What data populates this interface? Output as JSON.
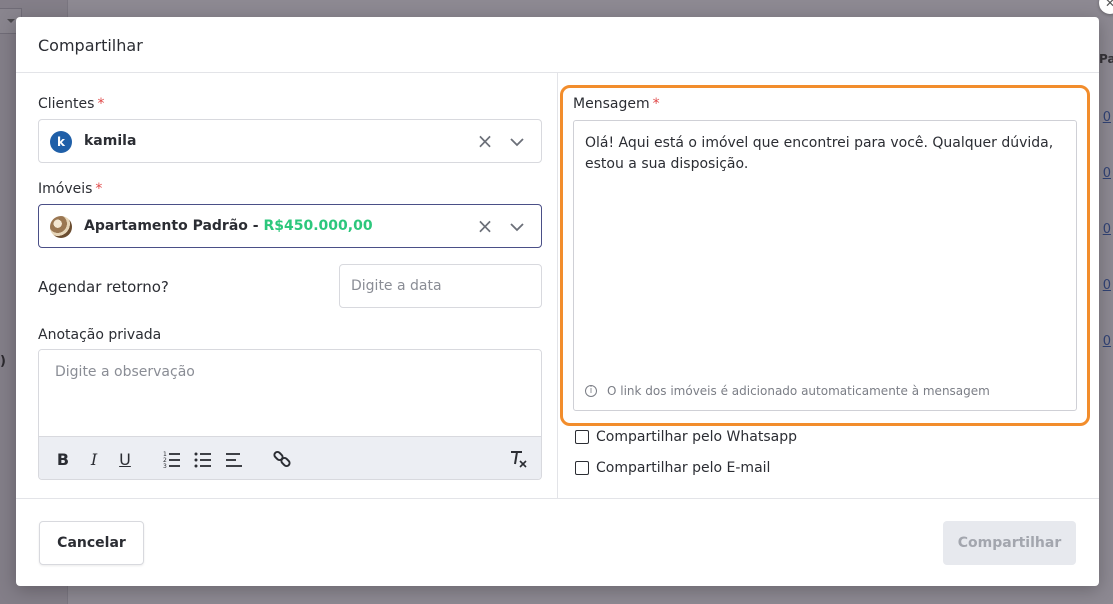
{
  "modal": {
    "title": "Compartilhar"
  },
  "form": {
    "clientes": {
      "label": "Clientes",
      "required_mark": "*",
      "avatar_letter": "k",
      "value": "kamila"
    },
    "imoveis": {
      "label": "Imóveis",
      "required_mark": "*",
      "value_name": "Apartamento Padrão - ",
      "value_price": "R$450.000,00"
    },
    "agendar": {
      "label": "Agendar retorno?",
      "placeholder": "Digite a data"
    },
    "anotacao": {
      "label": "Anotação privada",
      "placeholder": "Digite a observação"
    },
    "mensagem": {
      "label": "Mensagem",
      "required_mark": "*",
      "text": "Olá! Aqui está o imóvel que encontrei para você. Qualquer dúvida, estou a sua disposição.",
      "info": "O link dos imóveis é adicionado automaticamente à mensagem"
    },
    "checkboxes": [
      {
        "label": "Compartilhar pelo Whatsapp",
        "checked": false
      },
      {
        "label": "Compartilhar pelo E-mail",
        "checked": false
      }
    ]
  },
  "footer": {
    "cancel_label": "Cancelar",
    "share_label": "Compartilhar"
  },
  "background": {
    "paren": ")",
    "column_header": "Part",
    "link_text": "0"
  },
  "colors": {
    "accent_outline": "#f28d2c",
    "price_green": "#2cc77c",
    "required_red": "#e04848",
    "avatar_blue": "#1f5fa8"
  }
}
